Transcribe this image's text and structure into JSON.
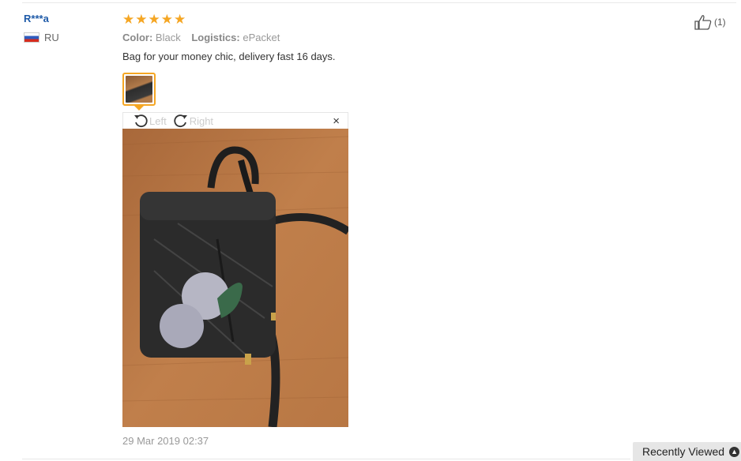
{
  "reviewer": {
    "name": "R***a",
    "country_code": "RU"
  },
  "review": {
    "rating": 5,
    "stars": [
      "★",
      "★",
      "★",
      "★",
      "★"
    ],
    "color_label": "Color:",
    "color_value": "Black",
    "logistics_label": "Logistics:",
    "logistics_value": "ePacket",
    "text": "Bag for your money chic, delivery fast 16 days.",
    "date": "29 Mar 2019 02:37"
  },
  "helpful": {
    "count_text": "(1)",
    "icon": "thumbs-up-icon"
  },
  "viewer": {
    "rotate_left_label": "Left",
    "rotate_right_label": "Right",
    "close_glyph": "×"
  },
  "recently_viewed": {
    "label": "Recently Viewed",
    "icon_glyph": "▲"
  },
  "colors": {
    "accent": "#f5a623",
    "link": "#1e5aa8",
    "muted": "#999999"
  }
}
